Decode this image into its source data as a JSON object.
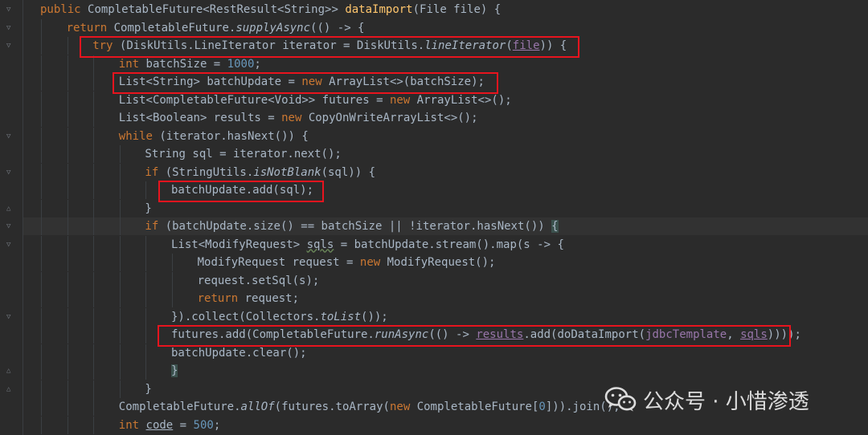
{
  "editor": {
    "language": "java",
    "theme": "darcula",
    "lines": [
      [
        {
          "t": "public ",
          "c": "kw"
        },
        {
          "t": "CompletableFuture<RestResult<String>> "
        },
        {
          "t": "dataImport",
          "c": "fn"
        },
        {
          "t": "(File file) {"
        }
      ],
      [
        {
          "t": "return ",
          "c": "kw"
        },
        {
          "t": "CompletableFuture."
        },
        {
          "t": "supplyAsync",
          "c": "it"
        },
        {
          "t": "(() -> {"
        }
      ],
      [
        {
          "t": "try ",
          "c": "kw"
        },
        {
          "t": "(DiskUtils.LineIterator iterator = DiskUtils."
        },
        {
          "t": "lineIterator",
          "c": "it"
        },
        {
          "t": "("
        },
        {
          "t": "file",
          "c": "fld ul"
        },
        {
          "t": ")) {"
        }
      ],
      [
        {
          "t": "int ",
          "c": "kw"
        },
        {
          "t": "batchSize = "
        },
        {
          "t": "1000",
          "c": "num"
        },
        {
          "t": ";"
        }
      ],
      [
        {
          "t": "List<String> batchUpdate = "
        },
        {
          "t": "new ",
          "c": "kw"
        },
        {
          "t": "ArrayList<>(batchSize);"
        }
      ],
      [
        {
          "t": "List<CompletableFuture<Void>> futures = "
        },
        {
          "t": "new ",
          "c": "kw"
        },
        {
          "t": "ArrayList<>();"
        }
      ],
      [
        {
          "t": "List<Boolean> results = "
        },
        {
          "t": "new ",
          "c": "kw"
        },
        {
          "t": "CopyOnWriteArrayList<>();"
        }
      ],
      [
        {
          "t": "while ",
          "c": "kw"
        },
        {
          "t": "(iterator.hasNext()) {"
        }
      ],
      [
        {
          "t": "String sql = iterator.next();"
        }
      ],
      [
        {
          "t": "if ",
          "c": "kw"
        },
        {
          "t": "(StringUtils."
        },
        {
          "t": "isNotBlank",
          "c": "it"
        },
        {
          "t": "(sql)) {"
        }
      ],
      [
        {
          "t": "batchUpdate.add(sql);"
        }
      ],
      [
        {
          "t": "}"
        }
      ],
      [
        {
          "t": "if ",
          "c": "kw"
        },
        {
          "t": "(batchUpdate.size() == batchSize || !iterator.hasNext()) "
        },
        {
          "t": "{",
          "c": "hl"
        }
      ],
      [
        {
          "t": "List<ModifyRequest> "
        },
        {
          "t": "sqls",
          "c": "wavy"
        },
        {
          "t": " = batchUpdate.stream().map(s -> {"
        }
      ],
      [
        {
          "t": "ModifyRequest request = "
        },
        {
          "t": "new ",
          "c": "kw"
        },
        {
          "t": "ModifyRequest();"
        }
      ],
      [
        {
          "t": "request.setSql(s);"
        }
      ],
      [
        {
          "t": "return ",
          "c": "kw"
        },
        {
          "t": "request;"
        }
      ],
      [
        {
          "t": "}).collect(Collectors."
        },
        {
          "t": "toList",
          "c": "it"
        },
        {
          "t": "());"
        }
      ],
      [
        {
          "t": "futures.add(CompletableFuture."
        },
        {
          "t": "runAsync",
          "c": "it"
        },
        {
          "t": "(() -> "
        },
        {
          "t": "results",
          "c": "fld ul"
        },
        {
          "t": ".add(doDataImport("
        },
        {
          "t": "jdbcTemplate",
          "c": "fld"
        },
        {
          "t": ", "
        },
        {
          "t": "sqls",
          "c": "fld ul"
        },
        {
          "t": "))));"
        }
      ],
      [
        {
          "t": "batchUpdate.clear();"
        }
      ],
      [
        {
          "t": "}",
          "c": "hl"
        }
      ],
      [
        {
          "t": "}"
        }
      ],
      [
        {
          "t": "CompletableFuture."
        },
        {
          "t": "allOf",
          "c": "it"
        },
        {
          "t": "(futures.toArray("
        },
        {
          "t": "new ",
          "c": "kw"
        },
        {
          "t": "CompletableFuture["
        },
        {
          "t": "0",
          "c": "num"
        },
        {
          "t": "])).join();"
        }
      ],
      [
        {
          "t": "int ",
          "c": "kw"
        },
        {
          "t": "code",
          "c": "ul"
        },
        {
          "t": " = "
        },
        {
          "t": "500",
          "c": "num"
        },
        {
          "t": ";"
        }
      ]
    ],
    "highlight_color": "#e8141e",
    "boxed_lines": [
      2,
      4,
      10,
      18
    ]
  },
  "watermark": {
    "icon": "wechat-icon",
    "text": "公众号 · 小惜渗透"
  }
}
